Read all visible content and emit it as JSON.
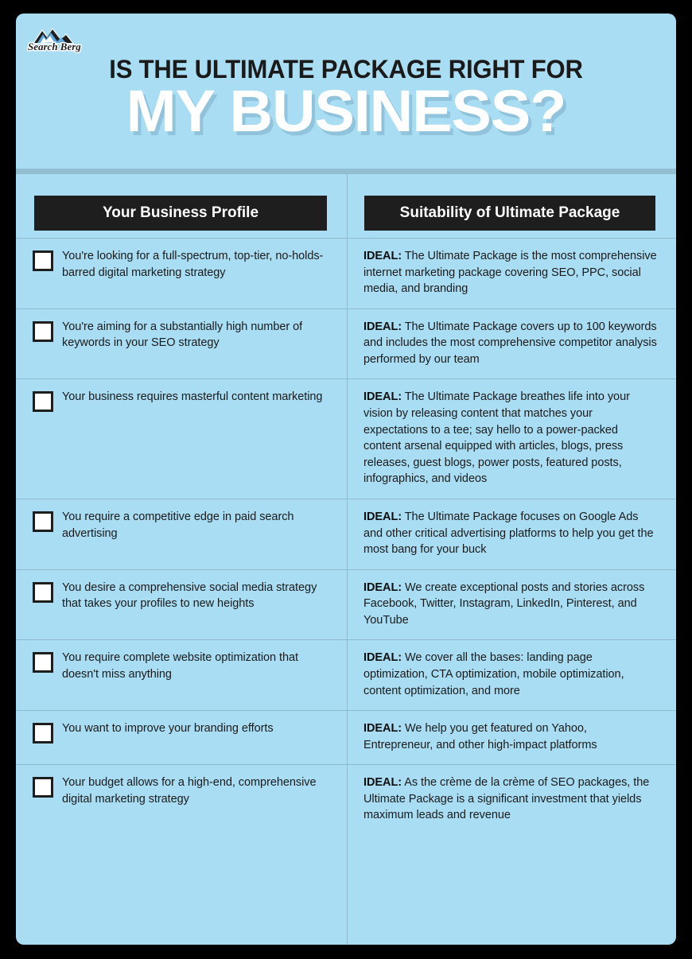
{
  "brand": {
    "logo_name": "search-berg-logo",
    "logo_text": "Search Berg"
  },
  "header": {
    "title_line1": "IS THE ULTIMATE PACKAGE RIGHT FOR",
    "title_line2": "MY BUSINESS?"
  },
  "colors": {
    "page_background": "#000000",
    "card_background": "#a9ddf3",
    "divider": "#8fb9cc",
    "header_band": "#93bed2",
    "pill_background": "#1e1e1e",
    "pill_text": "#ffffff",
    "body_text": "#1b1b1b",
    "title_line1_color": "#1a1a1a",
    "title_line2_color": "#ffffff"
  },
  "table": {
    "columns": [
      "Your Business Profile",
      "Suitability of Ultimate Package"
    ],
    "rows": [
      {
        "profile": "You're looking for a full-spectrum, top-tier, no-holds-barred digital marketing strategy",
        "verdict": "IDEAL:",
        "detail": " The Ultimate Package is the most comprehensive internet marketing package covering SEO, PPC, social media, and branding"
      },
      {
        "profile": "You're aiming for a substantially high number of keywords in your SEO strategy",
        "verdict": "IDEAL:",
        "detail": " The Ultimate Package covers up to 100 keywords and includes the most comprehensive competitor analysis performed by our team"
      },
      {
        "profile": "Your business requires masterful content marketing",
        "verdict": "IDEAL:",
        "detail": " The Ultimate Package breathes life into your vision by releasing content that matches your expectations to a tee; say hello to a power-packed content arsenal equipped with articles, blogs, press releases, guest blogs, power posts, featured posts, infographics, and videos"
      },
      {
        "profile": "You require a competitive edge in paid search advertising",
        "verdict": "IDEAL:",
        "detail": " The Ultimate Package focuses on Google Ads and other critical advertising platforms to help you get the most bang for your buck"
      },
      {
        "profile": "You desire a comprehensive social media strategy that takes your profiles to new heights",
        "verdict": "IDEAL:",
        "detail": " We create exceptional posts and stories across Facebook, Twitter, Instagram, LinkedIn, Pinterest, and YouTube"
      },
      {
        "profile": "You require complete website optimization that doesn't miss anything",
        "verdict": "IDEAL:",
        "detail": " We cover all the bases: landing page optimization, CTA optimization, mobile optimization, content optimization, and more"
      },
      {
        "profile": "You want to improve your branding efforts",
        "verdict": "IDEAL:",
        "detail": " We help you get featured on Yahoo, Entrepreneur, and other high-impact platforms"
      },
      {
        "profile": "Your budget allows for a high-end, comprehensive digital marketing strategy",
        "verdict": "IDEAL:",
        "detail": " As the crème de la crème of SEO packages, the Ultimate Package is a significant investment that yields maximum leads and revenue"
      }
    ]
  }
}
